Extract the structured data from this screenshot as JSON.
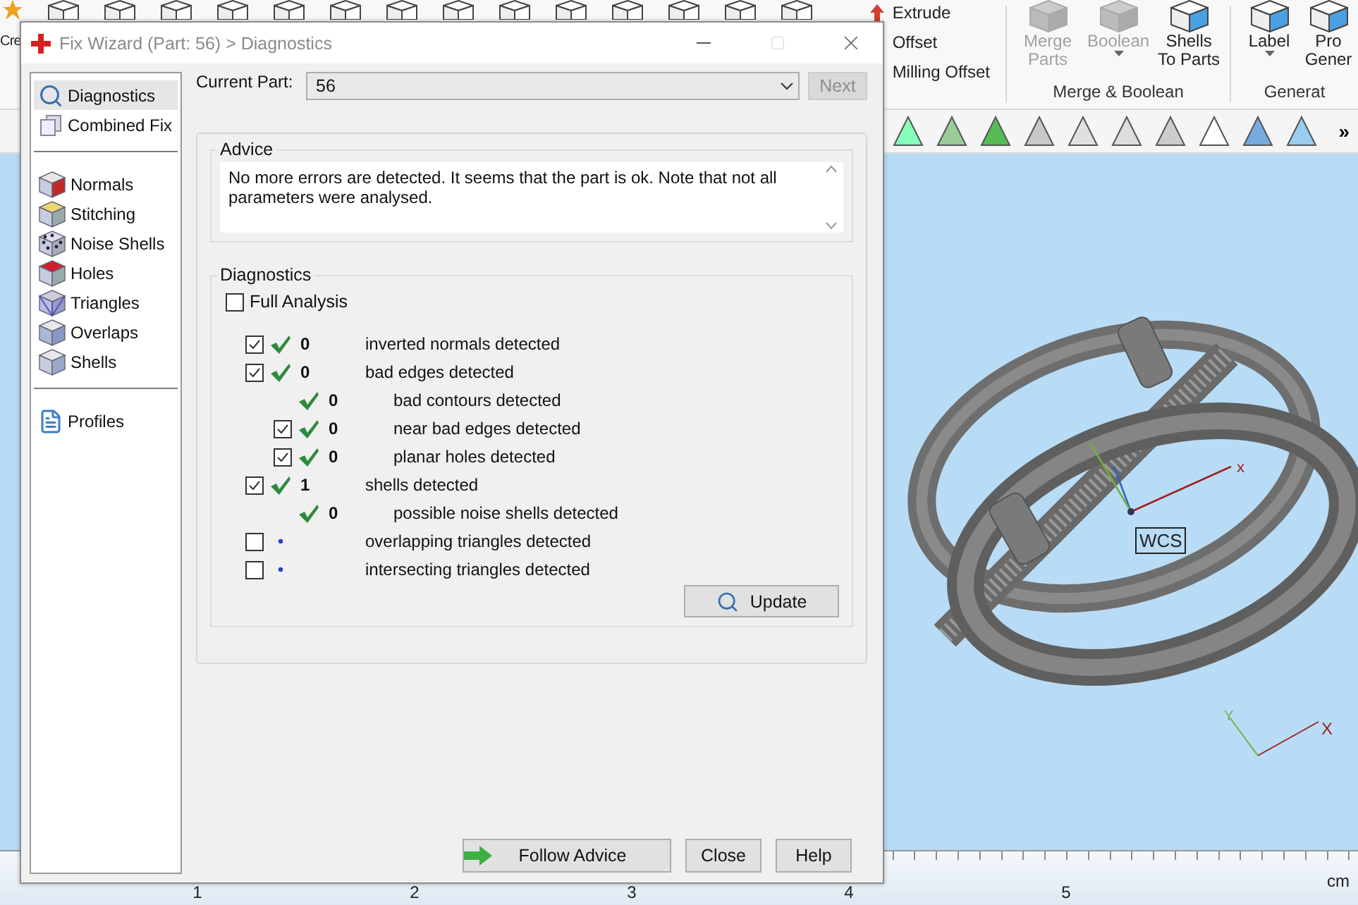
{
  "app": {
    "ribbon": {
      "cut_label": "Cre",
      "tools": [
        {
          "label": "Extrude"
        },
        {
          "label": "Offset"
        },
        {
          "label": "Milling Offset"
        }
      ],
      "groups": [
        {
          "label": "Merge & Boolean",
          "buttons": [
            {
              "label": "Merge Parts",
              "disabled": true,
              "dropdown": false
            },
            {
              "label": "Boolean",
              "disabled": true,
              "dropdown": true
            },
            {
              "label": "Shells To Parts",
              "disabled": false,
              "dropdown": false
            }
          ]
        },
        {
          "label": "Generat",
          "buttons": [
            {
              "label": "Label",
              "disabled": false,
              "dropdown": true
            },
            {
              "label": "Pro Gener",
              "disabled": false,
              "dropdown": false
            }
          ]
        }
      ]
    },
    "toolbar": {
      "more": "»"
    },
    "viewport": {
      "wcs_label": "WCS",
      "axis_label": "x",
      "triad_labels": [
        "Y",
        "X"
      ]
    },
    "ruler": {
      "ticks": [
        "1",
        "2",
        "3",
        "4",
        "5"
      ],
      "unit": "cm"
    }
  },
  "dialog": {
    "title": "Fix Wizard (Part: 56) > Diagnostics",
    "nav": [
      {
        "items": [
          {
            "label": "Diagnostics",
            "kind": "search",
            "selected": true
          },
          {
            "label": "Combined Fix",
            "kind": "stack",
            "selected": false
          }
        ]
      },
      {
        "items": [
          {
            "label": "Normals",
            "kind": "normals",
            "selected": false
          },
          {
            "label": "Stitching",
            "kind": "stitching",
            "selected": false
          },
          {
            "label": "Noise Shells",
            "kind": "noise",
            "selected": false
          },
          {
            "label": "Holes",
            "kind": "holes",
            "selected": false
          },
          {
            "label": "Triangles",
            "kind": "triangles",
            "selected": false
          },
          {
            "label": "Overlaps",
            "kind": "overlaps",
            "selected": false
          },
          {
            "label": "Shells",
            "kind": "shells",
            "selected": false
          }
        ]
      },
      {
        "items": [
          {
            "label": "Profiles",
            "kind": "document",
            "selected": false
          }
        ]
      }
    ],
    "current_part": {
      "label": "Current Part:",
      "value": "56"
    },
    "next_button": {
      "label": "Next",
      "disabled": true
    },
    "advice": {
      "title": "Advice",
      "text": "No more errors are detected. It seems that the part is ok. Note that not all parameters were analysed."
    },
    "diagnostics": {
      "title": "Diagnostics",
      "full_analysis": {
        "label": "Full Analysis",
        "checked": false
      },
      "rows": [
        {
          "kind": "checkbox",
          "checked": true,
          "passed": true,
          "count": "0",
          "label": "inverted normals detected"
        },
        {
          "kind": "checkbox",
          "checked": true,
          "passed": true,
          "count": "0",
          "label": "bad edges detected",
          "children": [
            {
              "kind": "plain",
              "passed": true,
              "count": "0",
              "label": "bad contours detected"
            },
            {
              "kind": "checkbox",
              "checked": true,
              "passed": true,
              "count": "0",
              "label": "near bad edges detected"
            },
            {
              "kind": "checkbox",
              "checked": true,
              "passed": true,
              "count": "0",
              "label": "planar holes detected"
            }
          ]
        },
        {
          "kind": "checkbox",
          "checked": true,
          "passed": true,
          "count": "1",
          "label": "shells detected",
          "children": [
            {
              "kind": "plain",
              "passed": true,
              "count": "0",
              "label": "possible noise shells detected"
            }
          ]
        },
        {
          "kind": "checkbox",
          "checked": false,
          "passed": false,
          "label": "overlapping triangles detected"
        },
        {
          "kind": "checkbox",
          "checked": false,
          "passed": false,
          "label": "intersecting triangles detected"
        }
      ],
      "update_button": "Update"
    },
    "buttons": [
      {
        "label": "Follow Advice",
        "kind": "advice"
      },
      {
        "label": "Close",
        "kind": "plain"
      },
      {
        "label": "Help",
        "kind": "plain"
      }
    ]
  }
}
